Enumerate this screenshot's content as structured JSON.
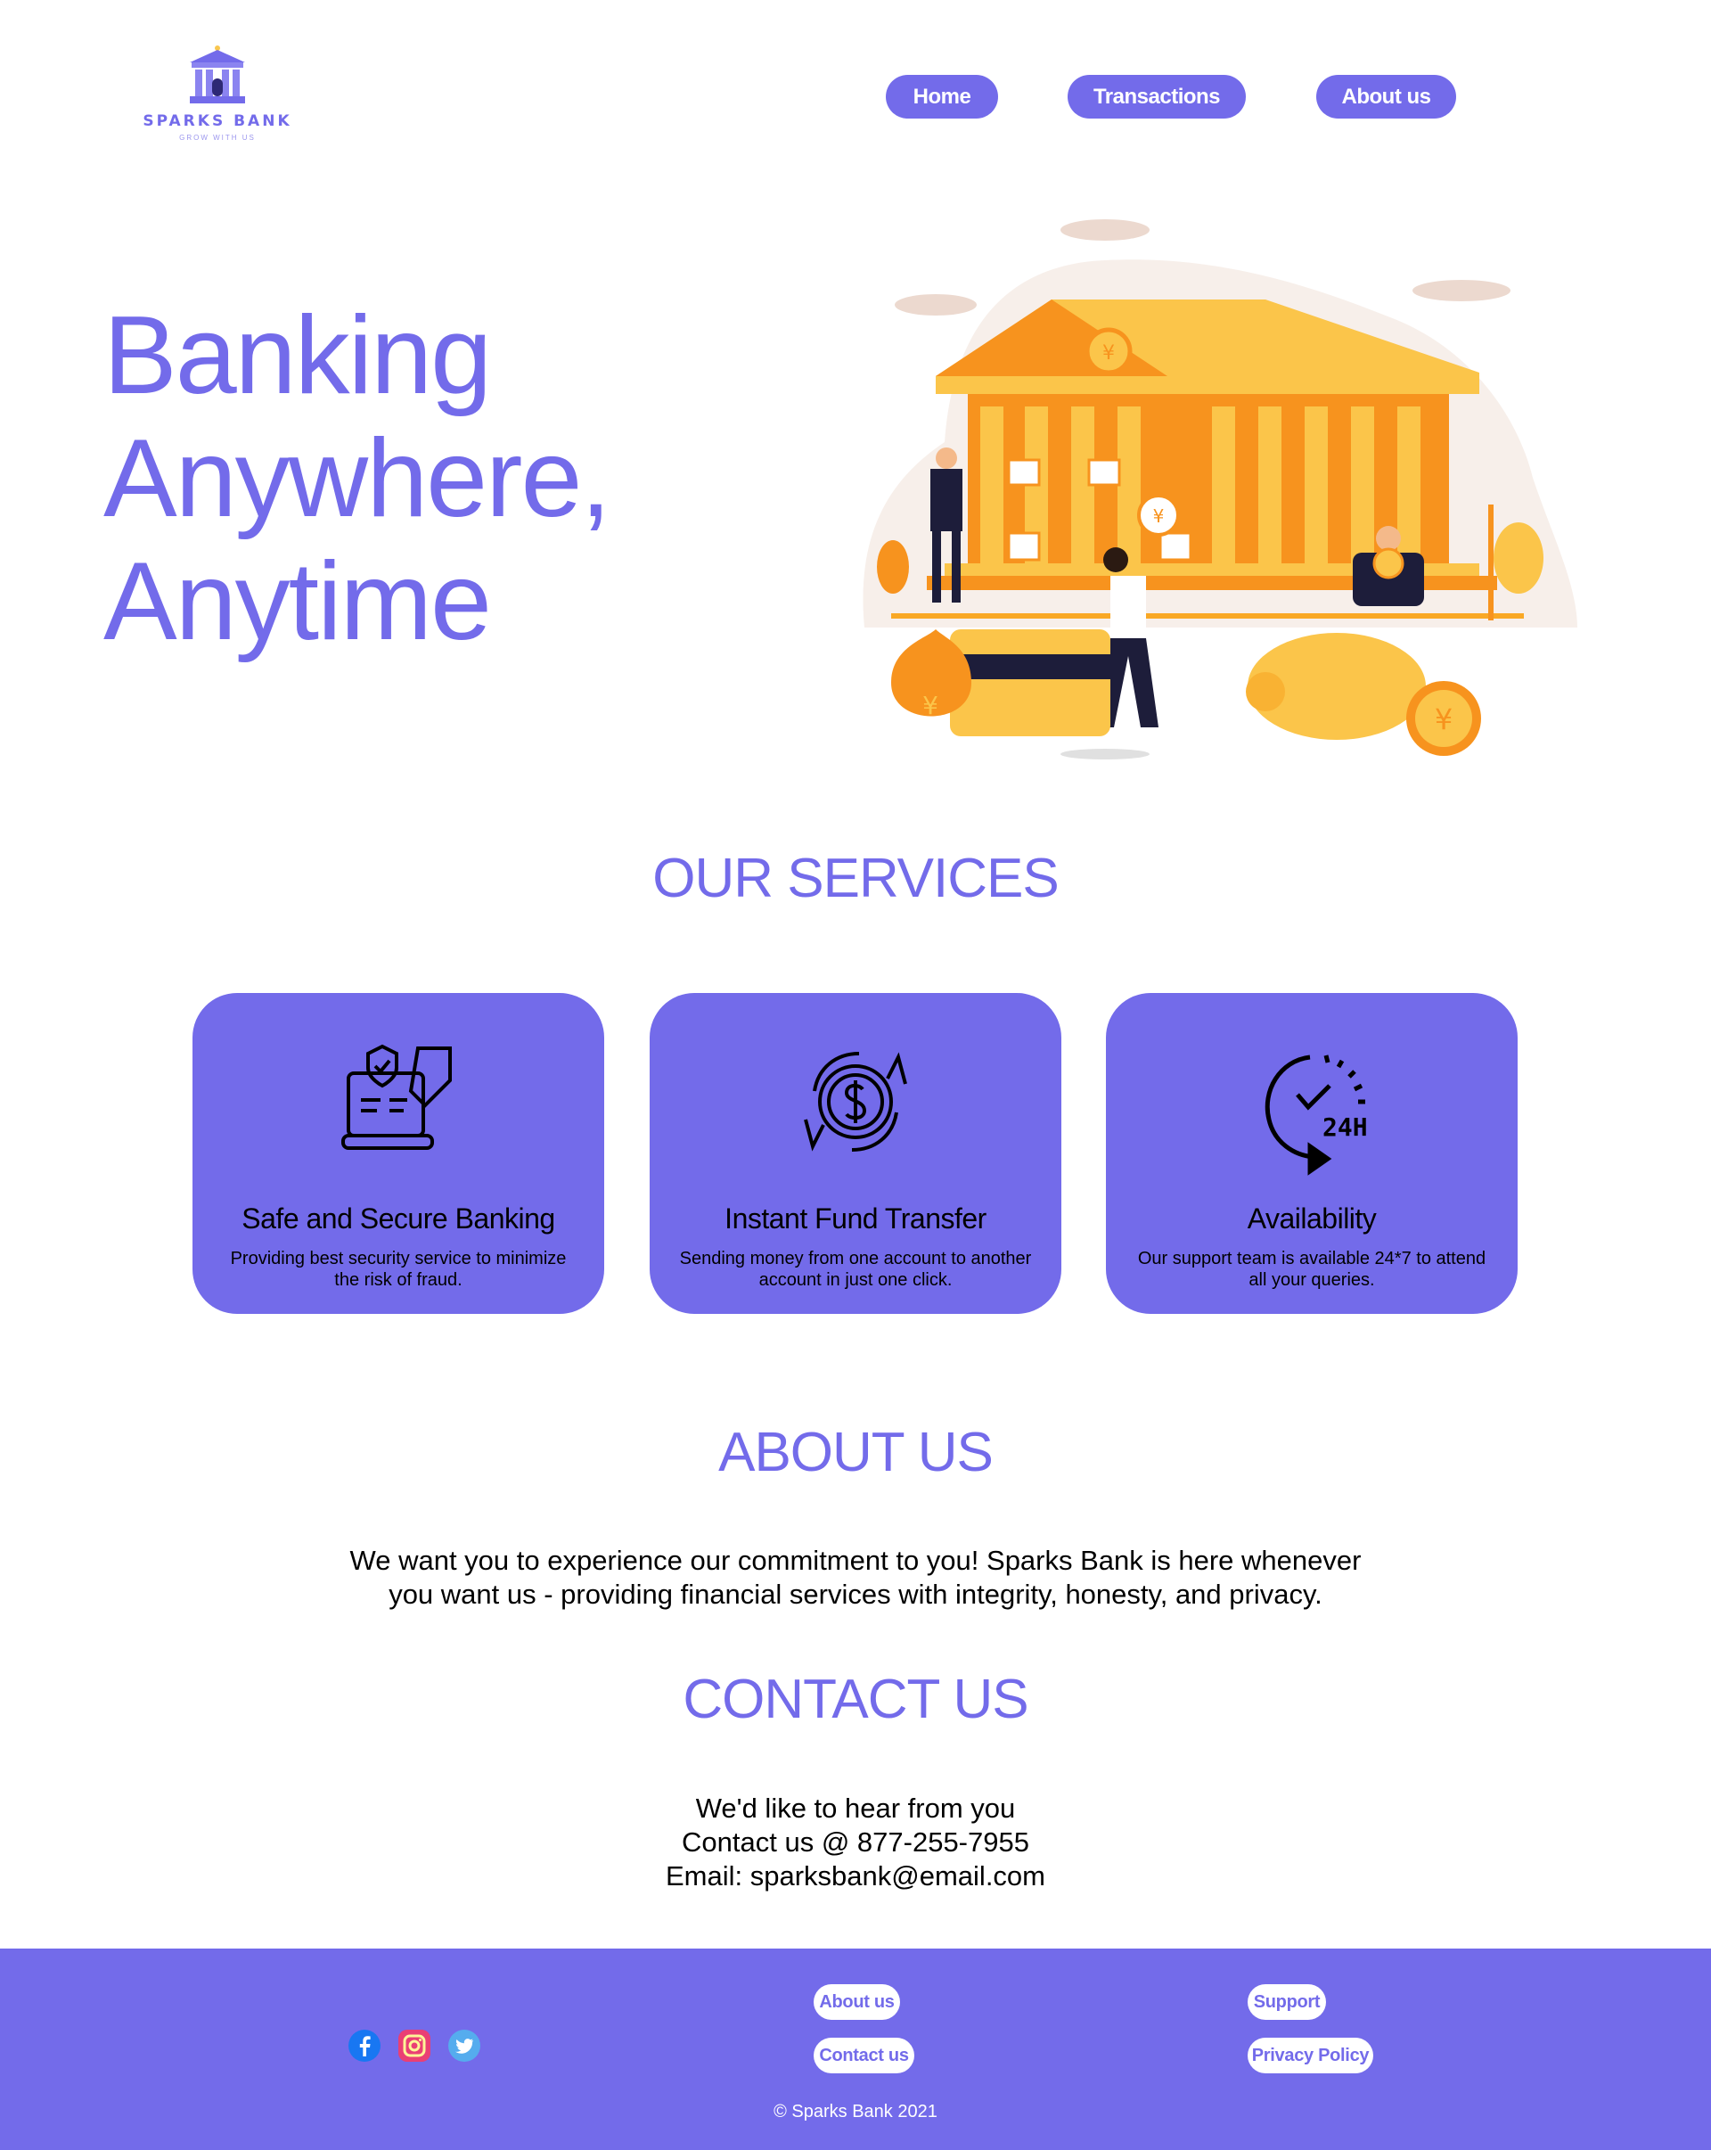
{
  "brand": {
    "name": "SPARKS BANK",
    "tagline": "GROW WITH US"
  },
  "nav": {
    "home": "Home",
    "transactions": "Transactions",
    "about": "About us"
  },
  "hero": {
    "line1": "Banking",
    "line2": "Anywhere,",
    "line3": "Anytime"
  },
  "services": {
    "title": "OUR SERVICES",
    "items": [
      {
        "title": "Safe and Secure Banking",
        "desc": "Providing best security service to minimize the risk of fraud."
      },
      {
        "title": "Instant Fund Transfer",
        "desc": "Sending money from one account to another account in just one click."
      },
      {
        "title": "Availability",
        "desc": "Our support team is available 24*7 to attend all your queries."
      }
    ]
  },
  "about": {
    "title": "ABOUT US",
    "text": "We want you to experience our commitment to you! Sparks Bank is here whenever you want us - providing financial services with integrity, honesty, and privacy."
  },
  "contact": {
    "title": "CONTACT US",
    "line1": "We'd like to hear from you",
    "line2": "Contact us @ 877-255-7955",
    "line3": "Email: sparksbank@email.com"
  },
  "footer": {
    "links": {
      "about": "About us",
      "contact": "Contact us",
      "support": "Support",
      "privacy": "Privacy Policy"
    },
    "copyright": "© Sparks Bank 2021",
    "icons": [
      "facebook-icon",
      "instagram-icon",
      "twitter-icon"
    ]
  },
  "colors": {
    "accent": "#736bea",
    "illustration_gold": "#f9a825",
    "illustration_orange": "#f7931e"
  }
}
